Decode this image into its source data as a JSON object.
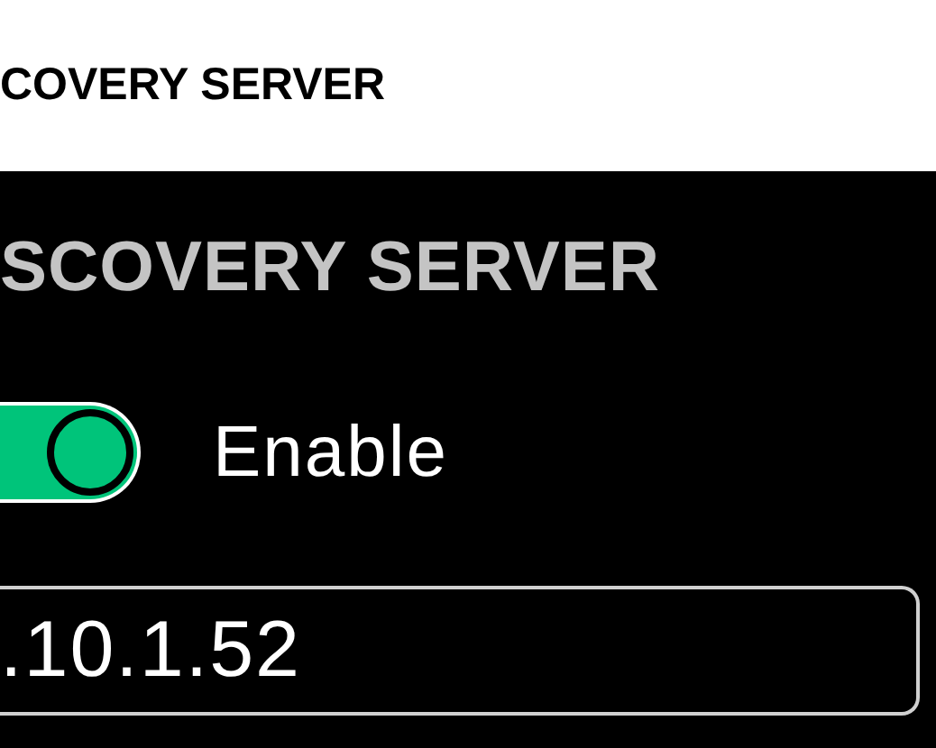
{
  "header": {
    "title": "COVERY SERVER"
  },
  "section": {
    "title": "SCOVERY SERVER"
  },
  "toggle": {
    "label": "Enable",
    "on": true
  },
  "field": {
    "value": ".10.1.52"
  }
}
